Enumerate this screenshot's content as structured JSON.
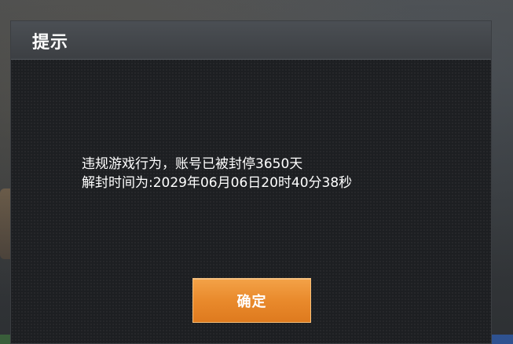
{
  "dialog": {
    "title": "提示",
    "message_line1": "违规游戏行为，账号已被封停3650天",
    "message_line2": "解封时间为:2029年06月06日20时40分38秒",
    "confirm_label": "确定"
  },
  "colors": {
    "button_accent": "#e98a2c",
    "dialog_background": "#1d1f22",
    "title_bar": "#44484c",
    "text": "#ffffff"
  }
}
